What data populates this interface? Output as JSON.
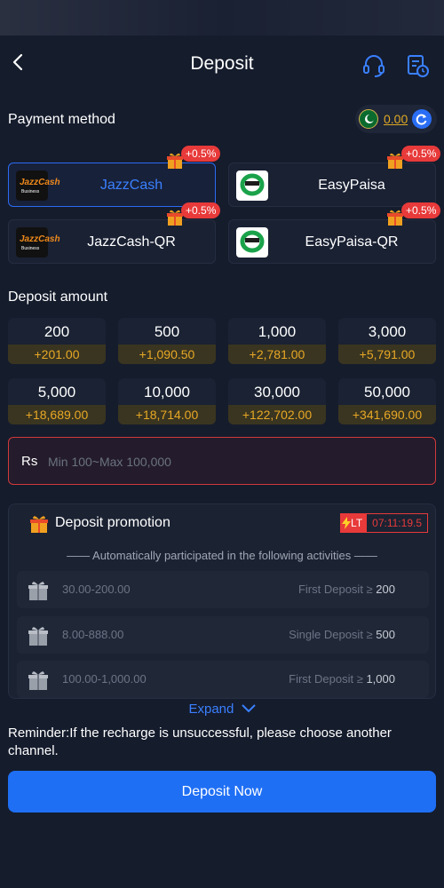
{
  "header": {
    "title": "Deposit",
    "back_icon": "back-arrow-icon",
    "support_icon": "headset-icon",
    "history_icon": "records-icon"
  },
  "payment": {
    "label": "Payment method",
    "balance": "0.00",
    "methods": [
      {
        "label": "JazzCash",
        "logo_text": "JazzCash",
        "logo_sub": "Business",
        "badge": "+0.5%"
      },
      {
        "label": "EasyPaisa",
        "badge": "+0.5%"
      },
      {
        "label": "JazzCash-QR",
        "logo_text": "JazzCash",
        "logo_sub": "Business",
        "badge": "+0.5%"
      },
      {
        "label": "EasyPaisa-QR",
        "badge": "+0.5%"
      }
    ]
  },
  "amount": {
    "label": "Deposit amount",
    "options": [
      {
        "value": "200",
        "bonus": "+201.00"
      },
      {
        "value": "500",
        "bonus": "+1,090.50"
      },
      {
        "value": "1,000",
        "bonus": "+2,781.00"
      },
      {
        "value": "3,000",
        "bonus": "+5,791.00"
      },
      {
        "value": "5,000",
        "bonus": "+18,689.00"
      },
      {
        "value": "10,000",
        "bonus": "+18,714.00"
      },
      {
        "value": "30,000",
        "bonus": "+122,702.00"
      },
      {
        "value": "50,000",
        "bonus": "+341,690.00"
      }
    ],
    "currency": "Rs",
    "placeholder": "Min 100~Max 100,000"
  },
  "promotion": {
    "title": "Deposit promotion",
    "lt_label": "LT",
    "countdown": "07:11:19.5",
    "auto_text": "—— Automatically participated in the following activities ——",
    "activities": [
      {
        "range": "30.00-200.00",
        "condition": "First Deposit ≥ ",
        "threshold": "200"
      },
      {
        "range": "8.00-888.00",
        "condition": "Single Deposit ≥ ",
        "threshold": "500"
      },
      {
        "range": "100.00-1,000.00",
        "condition": "First Deposit ≥ ",
        "threshold": "1,000"
      }
    ],
    "expand_label": "Expand"
  },
  "reminder": "Reminder:If the recharge is unsuccessful, please choose another channel.",
  "submit_label": "Deposit Now",
  "colors": {
    "accent": "#1f6ff5",
    "bonus": "#e8a825",
    "badge": "#e83a3a",
    "background": "#151c2c"
  }
}
